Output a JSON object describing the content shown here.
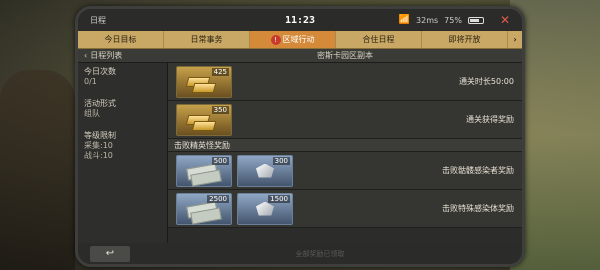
{
  "status_bar": {
    "app_title": "日程",
    "time": "11:23",
    "network": "32ms",
    "battery": "75%",
    "battery_level": 0.75
  },
  "tabs": [
    {
      "label": "今日目标"
    },
    {
      "label": "日常事务"
    },
    {
      "label": "区域行动",
      "active": true
    },
    {
      "label": "合住日程"
    },
    {
      "label": "即将开放"
    }
  ],
  "subheader": {
    "back_label": "日程列表",
    "title": "密斯卡园区副本"
  },
  "left": {
    "daily_count_label": "今日次数",
    "daily_count_value": "0/1",
    "activity_label": "活动形式",
    "activity_value": "组队",
    "level_label": "等级限制",
    "level_gather": "采集:10",
    "level_combat": "战斗:10"
  },
  "rewards": {
    "row1": {
      "qty": "425",
      "label": "通关时长50:00"
    },
    "row2": {
      "qty": "350",
      "label": "通关获得奖励"
    },
    "section_title": "击败精英怪奖励",
    "row3": {
      "qty_a": "500",
      "qty_b": "300",
      "label": "击败骷髅感染者奖励"
    },
    "row4": {
      "qty_a": "2500",
      "qty_b": "1500",
      "label": "击败特殊感染体奖励"
    }
  },
  "footer": {
    "return_icon": "↩",
    "text": "全部奖励已领取"
  },
  "icons": {
    "wifi": "wifi-icon",
    "close": "close-icon",
    "back": "chevron-left-icon",
    "return": "return-icon",
    "next": "chevron-right-icon"
  }
}
